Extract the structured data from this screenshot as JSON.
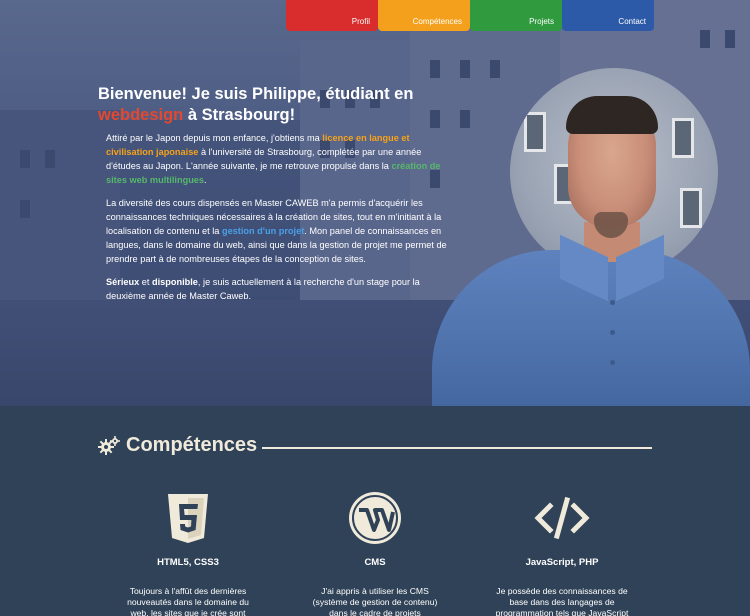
{
  "nav": {
    "items": [
      {
        "label": "Profil",
        "color": "#d92c2c"
      },
      {
        "label": "Compétences",
        "color": "#f4a01c"
      },
      {
        "label": "Projets",
        "color": "#2f9a3e"
      },
      {
        "label": "Contact",
        "color": "#2c5aa8"
      }
    ]
  },
  "intro": {
    "title_a": "Bienvenue! Je suis Philippe, étudiant en",
    "title_hl": "webdesign",
    "title_b": " à Strasbourg!",
    "p1": {
      "a": "Attiré par le Japon depuis mon enfance, j'obtiens ma ",
      "hl1": "licence en langue et civilisation japonaise",
      "b": " à l'université de Strasbourg, complétée par une année d'études au Japon. L'année suivante, je me retrouve propulsé dans la ",
      "hl2": "création de sites web multilingues",
      "c": "."
    },
    "p2": {
      "a": "La diversité des cours dispensés en Master CAWEB m'a permis d'acquérir les connaissances techniques nécessaires à la création de sites, tout en m'initiant à la localisation de contenu et la ",
      "hl": "gestion d'un projet",
      "b": ". Mon panel de connaissances en langues, dans le domaine du web, ainsi que dans la gestion de projet me permet de prendre part à de nombreuses étapes de la conception de sites."
    },
    "p3": {
      "b1": "Sérieux",
      "a": " et ",
      "b2": "disponible",
      "c": ", je suis actuellement à la recherche d'un stage pour la deuxième année de Master Caweb."
    }
  },
  "competences": {
    "title": "Compétences",
    "icon": "gears-icon",
    "skills": [
      {
        "icon": "html5-icon",
        "title": "HTML5, CSS3",
        "desc": "Toujours à l'affût des dernières nouveautés dans le domaine du web, les sites que je crée sont respectueux des standards web."
      },
      {
        "icon": "wordpress-icon",
        "title": "CMS",
        "desc": "J'ai appris à utiliser les CMS (système de gestion de contenu) dans le cadre de projets universitaires. J'ai travaillé sur"
      },
      {
        "icon": "code-icon",
        "title": "JavaScript, PHP",
        "desc": "Je possède des connaissances de base dans des langages de programmation tels que JavaScript et PHP, et je"
      }
    ]
  },
  "colors": {
    "accent_red": "#e4482f",
    "accent_orange": "#f6a21b",
    "accent_green": "#56b86b",
    "accent_blue": "#4aa0e6",
    "section_bg": "#2f4257",
    "heading_cream": "#f0eadb"
  }
}
